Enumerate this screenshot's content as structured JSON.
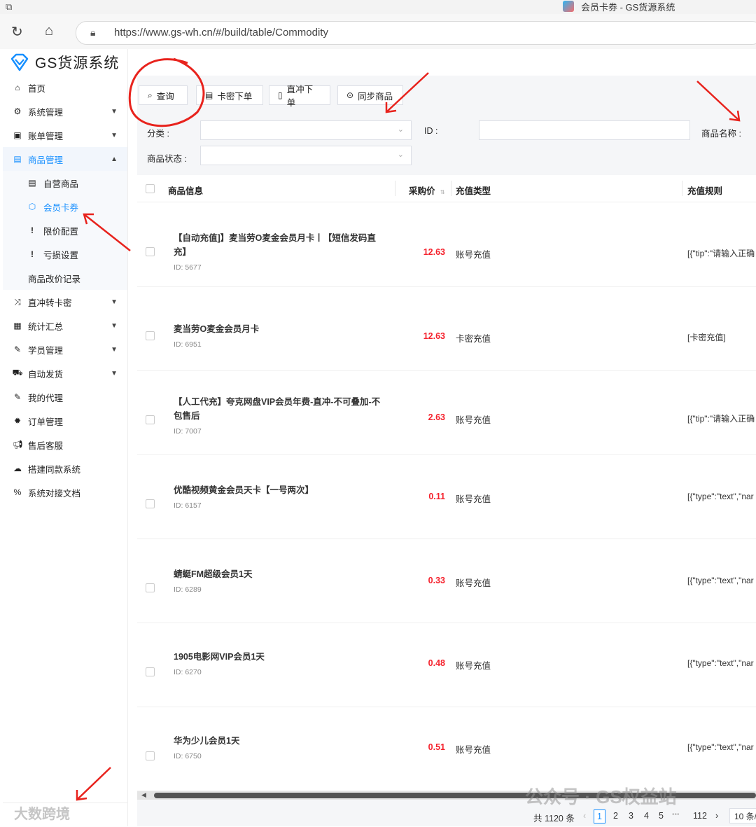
{
  "window": {
    "tab_title": "会员卡券 - GS货源系统"
  },
  "browser": {
    "url": "https://www.gs-wh.cn/#/build/table/Commodity"
  },
  "sidebar": {
    "logo_text": "GS货源系统",
    "items": [
      {
        "label": "首页",
        "icon": "home-icon"
      },
      {
        "label": "系统管理",
        "icon": "gears-icon"
      },
      {
        "label": "账单管理",
        "icon": "bill-icon"
      },
      {
        "label": "商品管理",
        "icon": "calendar-icon"
      },
      {
        "label": "直冲转卡密",
        "icon": "shuffle-icon"
      },
      {
        "label": "统计汇总",
        "icon": "table-icon"
      },
      {
        "label": "学员管理",
        "icon": "pen-icon"
      },
      {
        "label": "自动发货",
        "icon": "car-icon"
      },
      {
        "label": "我的代理",
        "icon": "pen-icon"
      },
      {
        "label": "订单管理",
        "icon": "gear-icon"
      },
      {
        "label": "售后客服",
        "icon": "megaphone-icon"
      },
      {
        "label": "搭建同款系统",
        "icon": "cloud-icon"
      },
      {
        "label": "系统对接文档",
        "icon": "link-icon"
      }
    ],
    "sub_items": [
      {
        "label": "自营商品",
        "icon": "calendar-icon"
      },
      {
        "label": "会员卡券",
        "icon": "hexagon-icon"
      },
      {
        "label": "限价配置",
        "icon": "exclamation-icon"
      },
      {
        "label": "亏损设置",
        "icon": "exclamation-icon"
      },
      {
        "label": "商品改价记录",
        "icon": ""
      }
    ]
  },
  "toolbar": {
    "query_label": "查询",
    "card_order_label": "卡密下单",
    "direct_order_label": "直冲下单",
    "sync_label": "同步商品"
  },
  "filters": {
    "category_label": "分类 :",
    "id_label": "ID :",
    "name_label": "商品名称 :",
    "status_label": "商品状态 :"
  },
  "table": {
    "headers": {
      "info": "商品信息",
      "price": "采购价",
      "type": "充值类型",
      "rule": "充值规则"
    },
    "rows": [
      {
        "name": "【自动充值]】麦当劳O麦金会员月卡丨【短信发码直充】",
        "id": "ID: 5677",
        "price": "12.63",
        "type": "账号充值",
        "rule": "[{\"tip\":\"请输入正确"
      },
      {
        "name": "麦当劳O麦金会员月卡",
        "id": "ID: 6951",
        "price": "12.63",
        "type": "卡密充值",
        "rule": "[卡密充值]"
      },
      {
        "name": "【人工代充】夸克网盘VIP会员年费-直冲-不可叠加-不包售后",
        "id": "ID: 7007",
        "price": "2.63",
        "type": "账号充值",
        "rule": "[{\"tip\":\"请输入正确"
      },
      {
        "name": "优酷视频黄金会员天卡【一号两次】",
        "id": "ID: 6157",
        "price": "0.11",
        "type": "账号充值",
        "rule": "[{\"type\":\"text\",\"nar"
      },
      {
        "name": "蜻蜓FM超级会员1天",
        "id": "ID: 6289",
        "price": "0.33",
        "type": "账号充值",
        "rule": "[{\"type\":\"text\",\"nar"
      },
      {
        "name": "1905电影网VIP会员1天",
        "id": "ID: 6270",
        "price": "0.48",
        "type": "账号充值",
        "rule": "[{\"type\":\"text\",\"nar"
      },
      {
        "name": "华为少儿会员1天",
        "id": "ID: 6750",
        "price": "0.51",
        "type": "账号充值",
        "rule": "[{\"type\":\"text\",\"nar"
      }
    ]
  },
  "pagination": {
    "total": "共 1120 条",
    "pages": [
      "1",
      "2",
      "3",
      "4",
      "5"
    ],
    "ellipsis": "•••",
    "last": "112",
    "page_size": "10 条/"
  },
  "watermarks": {
    "left": "大数跨境",
    "right": "公众号 · GS权益站"
  },
  "colors": {
    "accent": "#1890ff",
    "price": "#f5222d",
    "annotation": "#e8231d"
  }
}
